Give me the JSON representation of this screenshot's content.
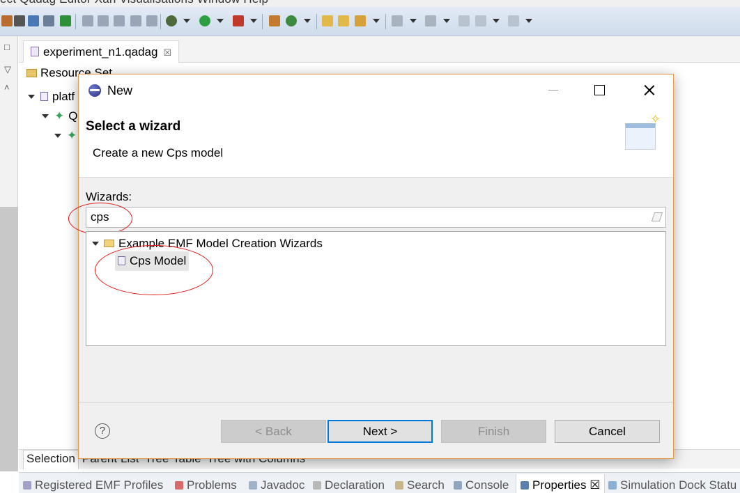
{
  "menubar": {
    "text": "ect   Qadag Editor   Xan   Visualisations   Window   Help"
  },
  "editor": {
    "tab_label": "experiment_n1.qadag",
    "tab_close": "☒"
  },
  "tree_bg": {
    "resource_set": "Resource Set",
    "row1": "platf",
    "row2": "Q",
    "row3": ""
  },
  "bottom_tabs": [
    "Selection",
    "Parent",
    "List",
    "Tree",
    "Table",
    "Tree with Columns"
  ],
  "views": [
    {
      "label": "Registered EMF Profiles",
      "active": false
    },
    {
      "label": "Problems",
      "active": false
    },
    {
      "label": "Javadoc",
      "active": false
    },
    {
      "label": "Declaration",
      "active": false
    },
    {
      "label": "Search",
      "active": false
    },
    {
      "label": "Console",
      "active": false
    },
    {
      "label": "Properties ☒",
      "active": true
    },
    {
      "label": "Simulation Dock Statu",
      "active": false
    }
  ],
  "dialog": {
    "title": "New",
    "header_title": "Select a wizard",
    "header_desc": "Create a new Cps model",
    "wizards_label": "Wizards:",
    "filter_value": "cps",
    "tree": {
      "category": "Example EMF Model Creation Wizards",
      "item": "Cps Model"
    },
    "help_symbol": "?",
    "buttons": {
      "back": "< Back",
      "next": "Next >",
      "finish": "Finish",
      "cancel": "Cancel"
    }
  },
  "icons": {
    "titlebar": "eclipse-icon",
    "minimize": "minimize-icon",
    "maximize": "maximize-icon",
    "close": "close-icon",
    "help": "help-icon",
    "filter_clear": "eraser-icon",
    "category": "open-folder-icon",
    "item": "model-file-icon"
  },
  "colors": {
    "annotation": "#e01616",
    "default_button_border": "#0078d7",
    "dialog_border": "#e49a4a"
  }
}
